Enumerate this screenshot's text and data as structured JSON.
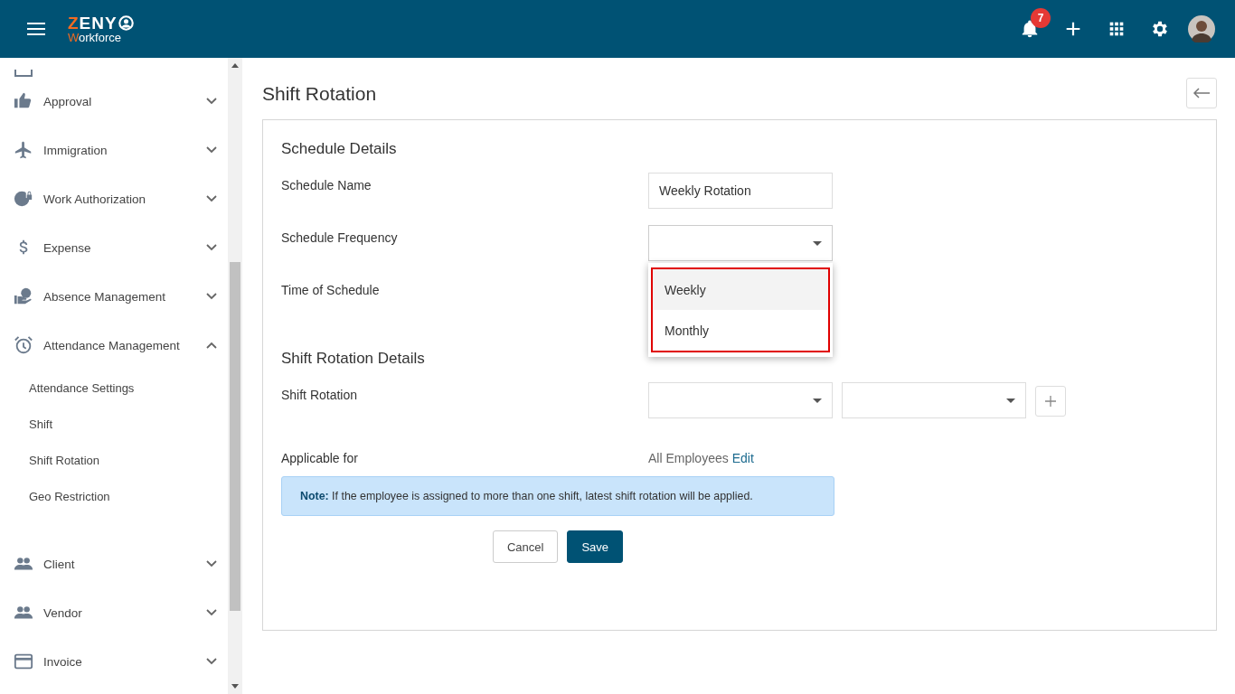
{
  "header": {
    "logo": {
      "top_initial": "Z",
      "top_rest": "ENY",
      "bottom_initial": "W",
      "bottom_rest": "orkforce"
    },
    "notifications": "7"
  },
  "sidebar": {
    "items": [
      {
        "label": "Approval",
        "expanded": false
      },
      {
        "label": "Immigration",
        "expanded": false
      },
      {
        "label": "Work Authorization",
        "expanded": false
      },
      {
        "label": "Expense",
        "expanded": false
      },
      {
        "label": "Absence Management",
        "expanded": false
      },
      {
        "label": "Attendance Management",
        "expanded": true,
        "children": [
          {
            "label": "Attendance Settings"
          },
          {
            "label": "Shift"
          },
          {
            "label": "Shift Rotation"
          },
          {
            "label": "Geo Restriction"
          }
        ]
      },
      {
        "label": "Client",
        "expanded": false
      },
      {
        "label": "Vendor",
        "expanded": false
      },
      {
        "label": "Invoice",
        "expanded": false
      }
    ]
  },
  "page": {
    "title": "Shift Rotation",
    "schedule_heading": "Schedule Details",
    "schedule_name": {
      "label": "Schedule Name",
      "value": "Weekly Rotation"
    },
    "schedule_frequency": {
      "label": "Schedule Frequency",
      "options": [
        {
          "label": "Weekly",
          "selected": true
        },
        {
          "label": "Monthly",
          "selected": false
        }
      ]
    },
    "time_of_schedule": {
      "label": "Time of Schedule"
    },
    "rotation_heading": "Shift Rotation Details",
    "shift_rotation": {
      "label": "Shift Rotation"
    },
    "applicable": {
      "label": "Applicable for",
      "value": "All Employees",
      "link": "Edit"
    },
    "note": "**Note:** If the employee is assigned to more than one shift, latest shift rotation will be applied.",
    "buttons": [
      "Cancel",
      "Save"
    ]
  }
}
